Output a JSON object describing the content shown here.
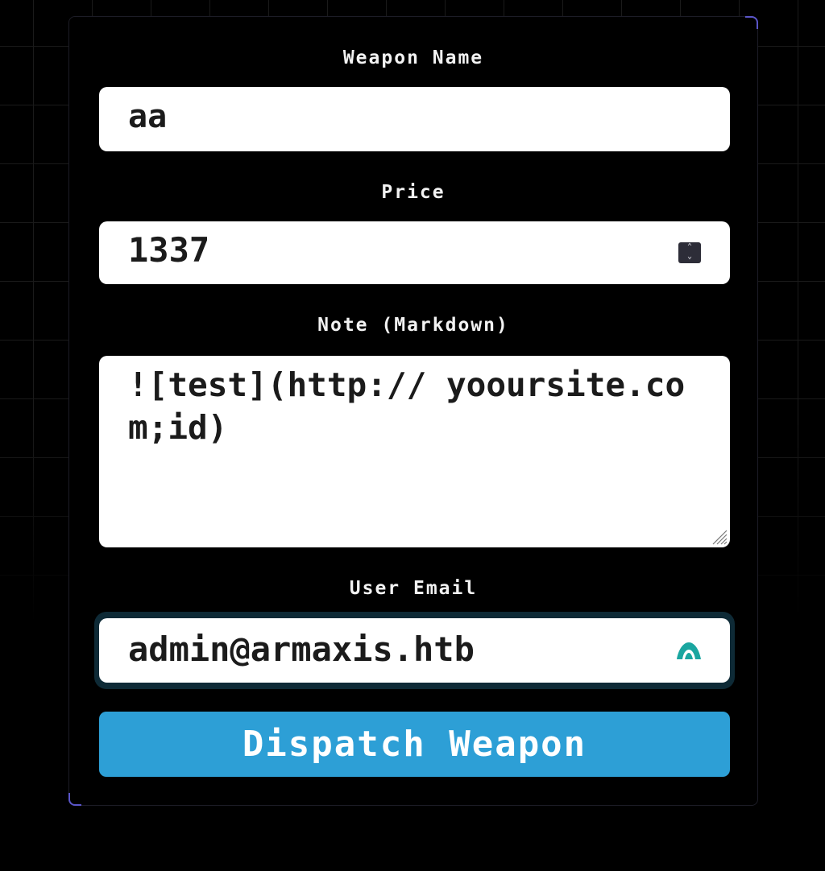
{
  "form": {
    "weapon_name": {
      "label": "Weapon Name",
      "value": "aa"
    },
    "price": {
      "label": "Price",
      "value": "1337",
      "spinner_up": "⌃",
      "spinner_down": "⌄"
    },
    "note": {
      "label": "Note (Markdown)",
      "value": "![test](http:// yooursite.com;id)"
    },
    "user_email": {
      "label": "User Email",
      "value": "admin@armaxis.htb",
      "autofill_icon": "password-manager-icon"
    },
    "submit_label": "Dispatch Weapon"
  },
  "colors": {
    "background": "#000000",
    "panel_border": "#1c1c26",
    "corner_accent": "#5a55c8",
    "field_background": "#ffffff",
    "field_text": "#1b1b1b",
    "focus_ring": "#0e2a36",
    "button": "#2d9fd6",
    "button_text": "#ffffff",
    "autofill_icon": "#1aa6a0"
  }
}
